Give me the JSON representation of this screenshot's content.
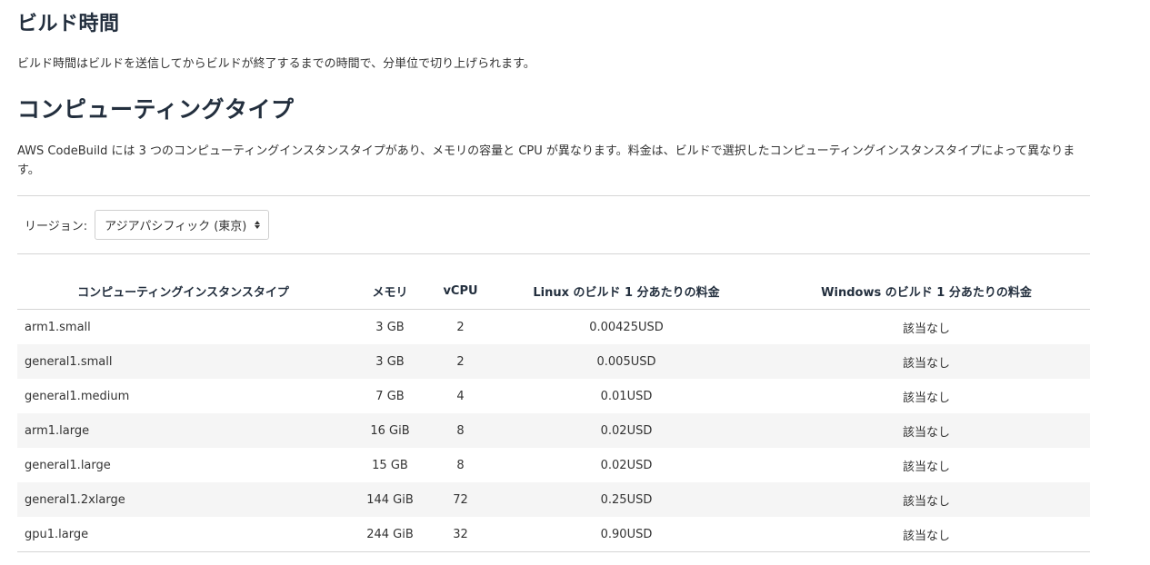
{
  "build_time": {
    "title": "ビルド時間",
    "description": "ビルド時間はビルドを送信してからビルドが終了するまでの時間で、分単位で切り上げられます。"
  },
  "compute_types": {
    "title": "コンピューティングタイプ",
    "description": "AWS CodeBuild には 3 つのコンピューティングインスタンスタイプがあり、メモリの容量と CPU が異なります。料金は、ビルドで選択したコンピューティングインスタンスタイプによって異なります。"
  },
  "region": {
    "label": "リージョン:",
    "selected": "アジアパシフィック (東京)"
  },
  "table": {
    "headers": [
      "コンピューティングインスタンスタイプ",
      "メモリ",
      "vCPU",
      "Linux のビルド 1 分あたりの料金",
      "Windows のビルド 1 分あたりの料金"
    ],
    "rows": [
      [
        "arm1.small",
        "3 GB",
        "2",
        "0.00425USD",
        "該当なし"
      ],
      [
        "general1.small",
        "3 GB",
        "2",
        "0.005USD",
        "該当なし"
      ],
      [
        "general1.medium",
        "7 GB",
        "4",
        "0.01USD",
        "該当なし"
      ],
      [
        "arm1.large",
        "16 GiB",
        "8",
        "0.02USD",
        "該当なし"
      ],
      [
        "general1.large",
        "15 GB",
        "8",
        "0.02USD",
        "該当なし"
      ],
      [
        "general1.2xlarge",
        "144 GiB",
        "72",
        "0.25USD",
        "該当なし"
      ],
      [
        "gpu1.large",
        "244 GiB",
        "32",
        "0.90USD",
        "該当なし"
      ]
    ]
  },
  "colors": {
    "heading": "#232f3e",
    "text": "#333333",
    "row_stripe": "#f5f5f5",
    "rule": "#d5d5d5"
  },
  "icons": {
    "region_select": "select-updown-arrows-icon"
  }
}
